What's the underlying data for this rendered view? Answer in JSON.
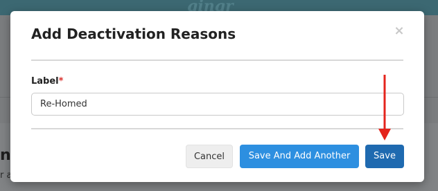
{
  "background": {
    "logo_text": "gingr",
    "heading_fragment": "ns",
    "sub_fragment": "r a"
  },
  "modal": {
    "title": "Add Deactivation Reasons",
    "close_symbol": "×",
    "field": {
      "label": "Label",
      "required_marker": "*",
      "value": "Re-Homed"
    },
    "buttons": {
      "cancel": "Cancel",
      "save_and_add_another": "Save And Add Another",
      "save": "Save"
    }
  },
  "colors": {
    "header": "#3c6872",
    "primary": "#2d8fe0",
    "primary_dark": "#1f6ab0",
    "annotation_arrow": "#e4241c",
    "required": "#d9302c"
  },
  "icons": {
    "close": "close-icon",
    "annotation": "red-arrow-icon"
  }
}
